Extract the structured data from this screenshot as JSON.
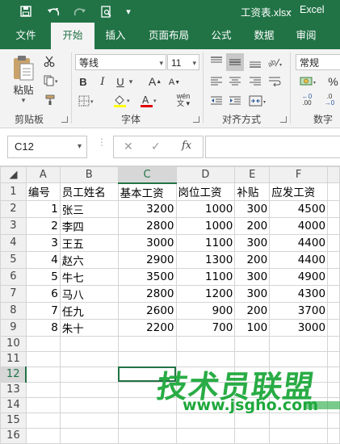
{
  "window": {
    "file_name": "工资表.xlsx",
    "separator": "-",
    "app_name": "Excel"
  },
  "qat": {
    "save_icon": "save-icon",
    "undo_icon": "undo-icon",
    "redo_icon": "redo-icon",
    "preview_icon": "print-preview-icon",
    "customize_icon": "chevron-down-icon"
  },
  "tabs": [
    "文件",
    "开始",
    "插入",
    "页面布局",
    "公式",
    "数据",
    "审阅"
  ],
  "ribbon": {
    "clipboard": {
      "paste_label": "粘贴",
      "group_label": "剪贴板"
    },
    "font": {
      "name": "等线",
      "size": "11",
      "bold": "B",
      "italic": "I",
      "underline": "U",
      "grow": "A",
      "shrink": "A",
      "phonetic": "wén",
      "group_label": "字体"
    },
    "alignment": {
      "group_label": "对齐方式"
    },
    "number": {
      "format": "常规",
      "percent": "%",
      "dec_inc": ".00",
      "dec_dec": ".0",
      "group_label": "数字"
    }
  },
  "formula_bar": {
    "name_box": "C12",
    "cancel": "✕",
    "enter": "✓",
    "fx": "fx",
    "value": ""
  },
  "sheet": {
    "columns": [
      "A",
      "B",
      "C",
      "D",
      "E",
      "F"
    ],
    "rows": [
      [
        "编号",
        "员工姓名",
        "基本工资",
        "岗位工资",
        "补贴",
        "应发工资"
      ],
      [
        "1",
        "张三",
        "3200",
        "1000",
        "300",
        "4500"
      ],
      [
        "2",
        "李四",
        "2800",
        "1000",
        "200",
        "4000"
      ],
      [
        "3",
        "王五",
        "3000",
        "1100",
        "300",
        "4400"
      ],
      [
        "4",
        "赵六",
        "2900",
        "1300",
        "200",
        "4400"
      ],
      [
        "5",
        "牛七",
        "3500",
        "1100",
        "300",
        "4900"
      ],
      [
        "6",
        "马八",
        "2800",
        "1200",
        "300",
        "4300"
      ],
      [
        "7",
        "任九",
        "2600",
        "900",
        "200",
        "3700"
      ],
      [
        "8",
        "朱十",
        "2200",
        "700",
        "100",
        "3000"
      ],
      [
        "",
        "",
        "",
        "",
        "",
        ""
      ],
      [
        "",
        "",
        "",
        "",
        "",
        ""
      ],
      [
        "",
        "",
        "",
        "",
        "",
        ""
      ],
      [
        "",
        "",
        "",
        "",
        "",
        ""
      ],
      [
        "",
        "",
        "",
        "",
        "",
        ""
      ],
      [
        "",
        "",
        "",
        "",
        "",
        ""
      ],
      [
        "",
        "",
        "",
        "",
        "",
        ""
      ]
    ],
    "selected_cell": "C12"
  },
  "watermark": {
    "title": "技术员联盟",
    "url": "www.jsgho.com"
  },
  "colors": {
    "accent": "#217346",
    "grid": "#d4d4d4",
    "watermark": "#1ea83c"
  }
}
